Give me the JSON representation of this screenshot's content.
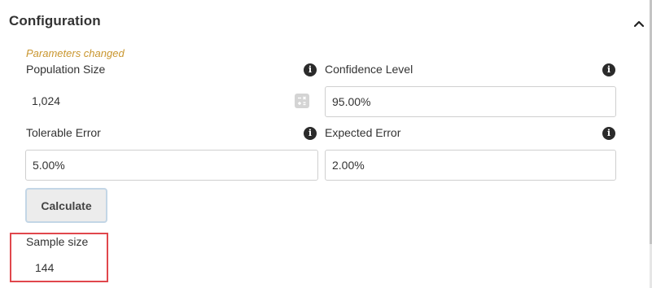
{
  "panel": {
    "title": "Configuration",
    "collapse_icon": "chevron-up-icon"
  },
  "form": {
    "status_note": "Parameters changed",
    "population_size": {
      "label": "Population Size",
      "value": "1,024",
      "info_icon": "info-icon",
      "action_icon": "calculator-icon"
    },
    "confidence_level": {
      "label": "Confidence Level",
      "value": "95.00%",
      "info_icon": "info-icon"
    },
    "tolerable_error": {
      "label": "Tolerable Error",
      "value": "5.00%",
      "info_icon": "info-icon"
    },
    "expected_error": {
      "label": "Expected Error",
      "value": "2.00%",
      "info_icon": "info-icon"
    },
    "calculate_label": "Calculate"
  },
  "result": {
    "label": "Sample size",
    "value": "144"
  },
  "colors": {
    "note": "#c9962f",
    "highlight": "#e0474c",
    "button_border": "#c3d6e6",
    "info_icon_bg": "#2b2b2b"
  }
}
